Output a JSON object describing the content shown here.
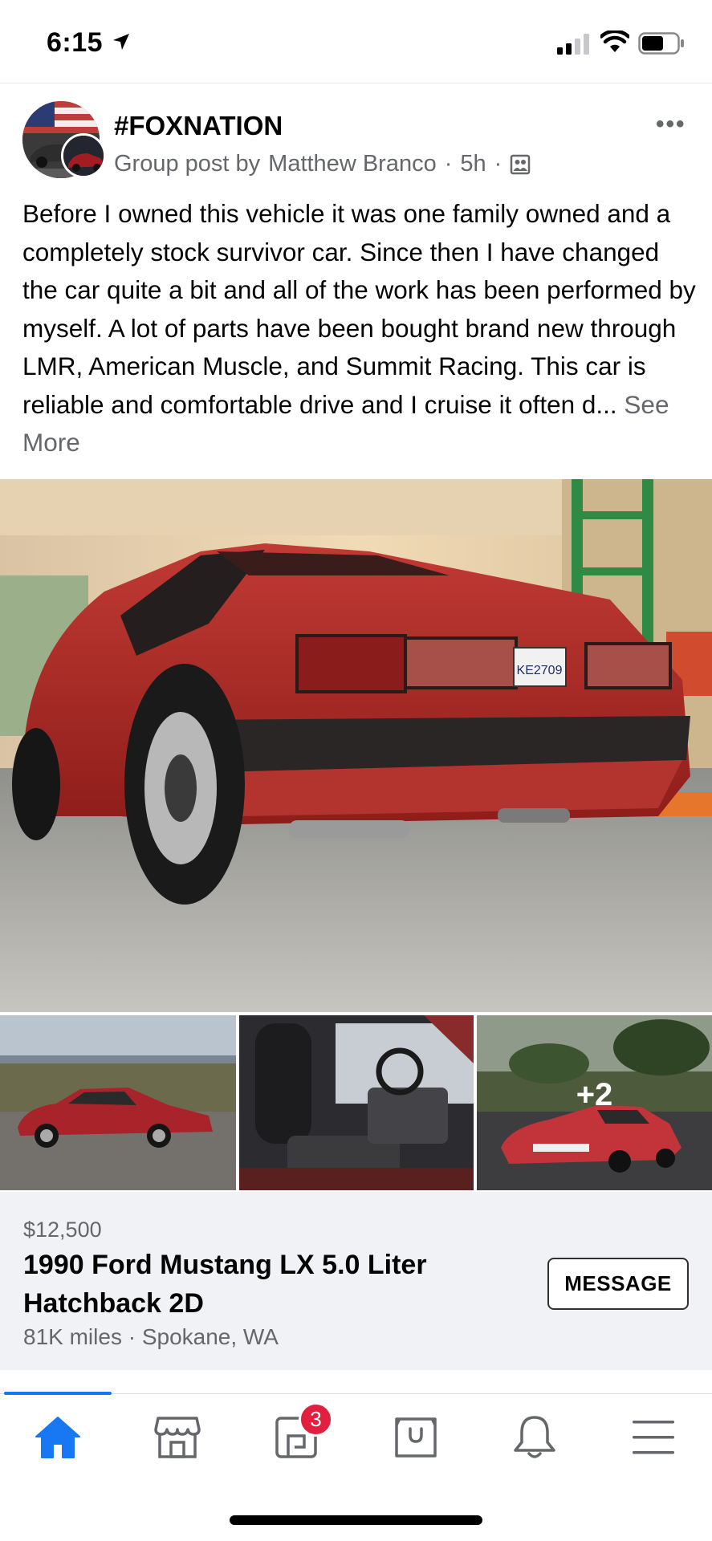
{
  "status_bar": {
    "time": "6:15"
  },
  "post": {
    "group_name": "#FOXNATION",
    "meta_prefix": "Group post by",
    "author": "Matthew Branco",
    "time_ago": "5h",
    "body": "Before I owned this vehicle it was one family owned and a completely stock survivor car. Since then I have changed the car quite a bit and all of the work has been performed by myself. A lot of parts have been bought brand new through LMR, American Muscle, and Summit Racing. This car is reliable and comfortable drive and I cruise it often d...",
    "see_more": "See More",
    "more_photos": "+2",
    "license_plate": "KE2709"
  },
  "listing": {
    "price": "$12,500",
    "title": "1990 Ford Mustang LX 5.0 Liter Hatchback 2D",
    "details": "81K miles · Spokane, WA",
    "message_button": "MESSAGE"
  },
  "bottom_nav": {
    "items": [
      {
        "icon": "home-icon",
        "active": true
      },
      {
        "icon": "marketplace-icon"
      },
      {
        "icon": "groups-icon",
        "badge": "3"
      },
      {
        "icon": "shop-bag-icon"
      },
      {
        "icon": "bell-icon"
      },
      {
        "icon": "menu-icon"
      }
    ],
    "active_color": "#1877f2"
  },
  "colors": {
    "brand": "#1877f2",
    "badge": "#e41e3f",
    "muted": "#65676b",
    "card_bg": "#f0f2f5"
  }
}
